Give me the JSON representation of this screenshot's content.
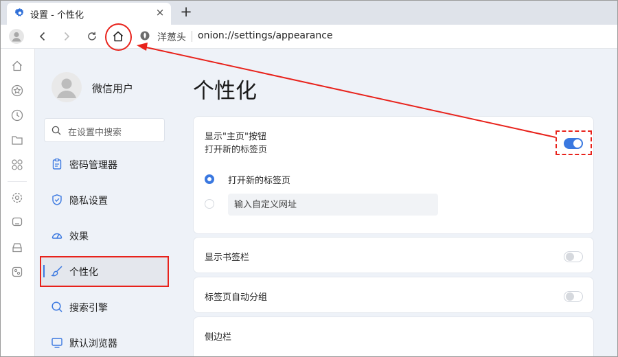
{
  "tab": {
    "title": "设置 - 个性化",
    "close": "×",
    "new_tab": "+"
  },
  "toolbar": {
    "site_name": "洋葱头",
    "url": "onion://settings/appearance"
  },
  "rail": {
    "icons": [
      "home-icon",
      "star-icon",
      "history-icon",
      "folder-icon",
      "apps-icon",
      "settings-icon",
      "chat-icon",
      "download-icon",
      "tools-icon"
    ]
  },
  "nav": {
    "profile_name": "微信用户",
    "search_placeholder": "在设置中搜索",
    "items": [
      {
        "label": "密码管理器",
        "icon": "clipboard-icon"
      },
      {
        "label": "隐私设置",
        "icon": "shield-icon"
      },
      {
        "label": "效果",
        "icon": "gauge-icon"
      },
      {
        "label": "个性化",
        "icon": "brush-icon",
        "active": true
      },
      {
        "label": "搜索引擎",
        "icon": "search-icon"
      },
      {
        "label": "默认浏览器",
        "icon": "monitor-icon"
      }
    ]
  },
  "content": {
    "title": "个性化",
    "home_button": {
      "title": "显示\"主页\"按钮",
      "subtitle": "打开新的标签页",
      "enabled": true,
      "options": [
        {
          "label": "打开新的标签页",
          "selected": true
        },
        {
          "placeholder": "输入自定义网址",
          "selected": false
        }
      ]
    },
    "bookmarks_bar": {
      "title": "显示书签栏",
      "enabled": false
    },
    "tab_grouping": {
      "title": "标签页自动分组",
      "enabled": false
    },
    "sidebar": {
      "title": "侧边栏"
    }
  },
  "colors": {
    "accent": "#3a78e0",
    "annotation": "#e8221b",
    "nav_bg": "#eef2f8"
  }
}
